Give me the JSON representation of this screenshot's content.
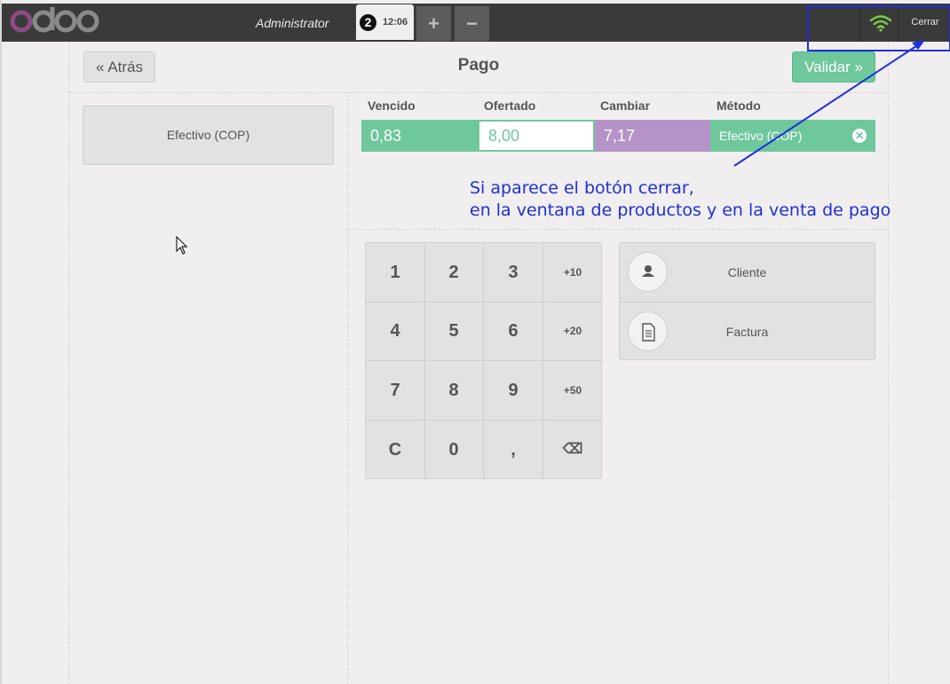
{
  "topbar": {
    "logo_text": "odoo",
    "cashier": "Administrator",
    "order_number": "2",
    "order_time": "12:06",
    "add_order_icon": "plus-icon",
    "remove_order_icon": "minus-icon",
    "connection_icon": "wifi-icon",
    "close_label": "Cerrar"
  },
  "payment": {
    "back_label": "« Atrás",
    "title": "Pago",
    "validate_label": "Validar »",
    "payment_methods": [
      "Efectivo (COP)"
    ],
    "columns": {
      "due": "Vencido",
      "tendered": "Ofertado",
      "change": "Cambiar",
      "method": "Método"
    },
    "line": {
      "due": "0,83",
      "tendered": "8,00",
      "change": "7,17",
      "method": "Efectivo (COP)"
    },
    "numpad": [
      "1",
      "2",
      "3",
      "+10",
      "4",
      "5",
      "6",
      "+20",
      "7",
      "8",
      "9",
      "+50",
      "C",
      "0",
      ",",
      "⌫"
    ],
    "actions": [
      {
        "icon": "user-icon",
        "label": "Cliente"
      },
      {
        "icon": "invoice-icon",
        "label": "Factura"
      }
    ]
  },
  "annotation": {
    "line1": "Si aparece el botón cerrar,",
    "line2": "en la ventana de productos y en la venta de pago"
  },
  "colors": {
    "topbar": "#3a3a3a",
    "accent_green": "#6ec89b",
    "change_purple": "#b593c8",
    "annotation_blue": "#1f2fe0",
    "logo_purple": "#8e4a86"
  }
}
